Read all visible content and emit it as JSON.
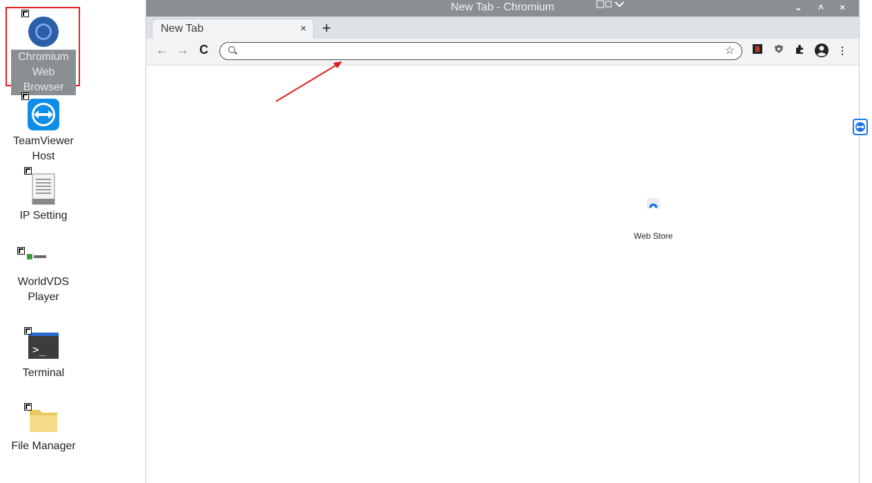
{
  "desktop": {
    "icons": [
      {
        "label_line1": "Chromium",
        "label_line2": "Web Browser",
        "icon": "chromium-icon"
      },
      {
        "label_line1": "TeamViewer",
        "label_line2": "Host",
        "icon": "teamviewer-icon"
      },
      {
        "label_line1": "IP Setting",
        "label_line2": "",
        "icon": "text-file-icon"
      },
      {
        "label_line1": "WorldVDS",
        "label_line2": "Player",
        "icon": "worldvds-icon"
      },
      {
        "label_line1": "Terminal",
        "label_line2": "",
        "icon": "terminal-icon"
      },
      {
        "label_line1": "File Manager",
        "label_line2": "",
        "icon": "folder-icon"
      }
    ]
  },
  "browser": {
    "window_title": "New Tab - Chromium",
    "tab_title": "New Tab",
    "tab_close": "×",
    "new_tab": "+",
    "back": "←",
    "forward": "→",
    "reload": "C",
    "omnibox_value": "",
    "bookmark_star": "☆",
    "menu": "⋮",
    "window_controls": "⌄ ˄ ×",
    "shortcut_tile_label": "Web Store"
  },
  "colors": {
    "titlebar": "#8a8f91",
    "annotation": "#e31b1b",
    "accent": "#1a73e8"
  }
}
